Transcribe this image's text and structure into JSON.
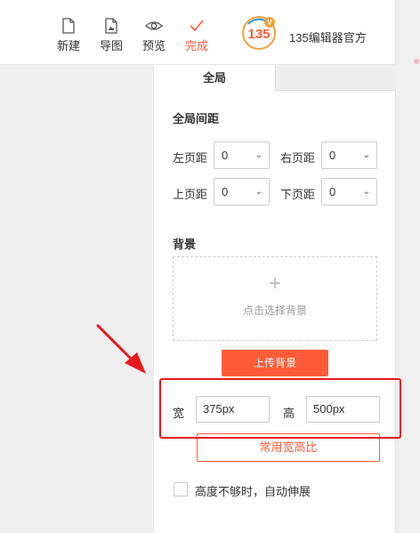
{
  "toolbar": {
    "items": [
      {
        "label": "新建",
        "icon": "file-icon"
      },
      {
        "label": "导图",
        "icon": "image-file-icon"
      },
      {
        "label": "预览",
        "icon": "eye-icon"
      },
      {
        "label": "完成",
        "icon": "checkmark-icon"
      }
    ],
    "accent_color": "#ff5b38"
  },
  "brand": {
    "logo_text": "135",
    "logo_badge": "V",
    "name": "135编辑器官方"
  },
  "panel": {
    "tab": "全局",
    "spacing": {
      "title": "全局间距",
      "left": {
        "label": "左页距",
        "value": "0"
      },
      "right": {
        "label": "右页距",
        "value": "0"
      },
      "top": {
        "label": "上页距",
        "value": "0"
      },
      "bottom": {
        "label": "下页距",
        "value": "0"
      }
    },
    "background": {
      "title": "背景",
      "plus": "+",
      "hint": "点击选择背景",
      "upload_label": "上传背景"
    },
    "size": {
      "width_label": "宽",
      "width_value": "375px",
      "height_label": "高",
      "height_value": "500px",
      "ratio_button": "常用宽高比"
    },
    "auto_extend": {
      "label": "高度不够时，自动伸展",
      "checked": false
    }
  },
  "annotation": {
    "color": "#e8191e"
  }
}
